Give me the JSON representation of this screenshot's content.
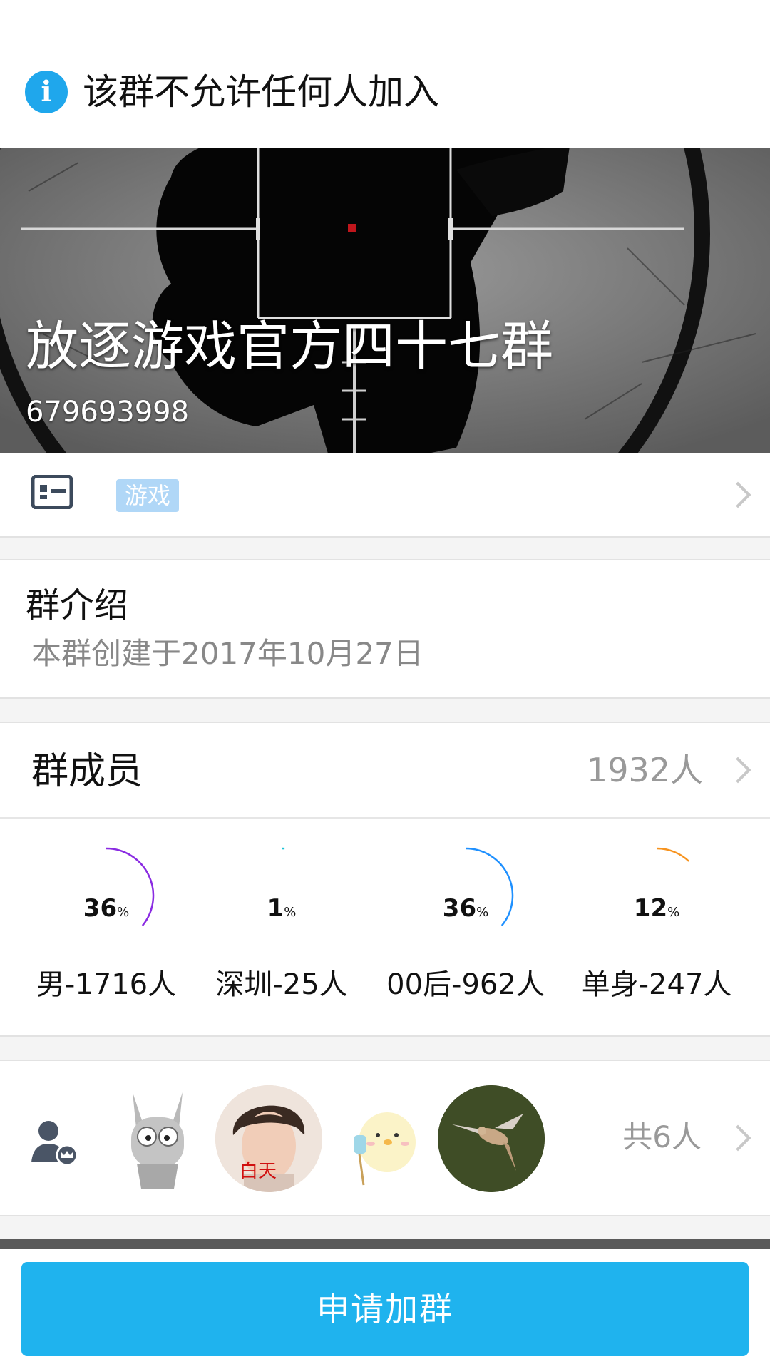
{
  "notice": {
    "icon": "info-icon",
    "text": "该群不允许任何人加入"
  },
  "banner": {
    "group_name": "放逐游戏官方四十七群",
    "group_id": "679693998"
  },
  "tag_row": {
    "card_icon": "id-card-icon",
    "tag": "游戏"
  },
  "intro": {
    "title": "群介绍",
    "description": "本群创建于2017年10月27日"
  },
  "members": {
    "title": "群成员",
    "count": "1932人",
    "stats": [
      {
        "percent": 36,
        "percent_text": "36",
        "unit": "%",
        "label": "男-1716人",
        "color": "#8a2be2"
      },
      {
        "percent": 1,
        "percent_text": "1",
        "unit": "%",
        "label": "深圳-25人",
        "color": "#19c3d6"
      },
      {
        "percent": 36,
        "percent_text": "36",
        "unit": "%",
        "label": "00后-962人",
        "color": "#1e90ff"
      },
      {
        "percent": 12,
        "percent_text": "12",
        "unit": "%",
        "label": "单身-247人",
        "color": "#f7931e"
      }
    ]
  },
  "admins": {
    "icon": "admin-crown-icon",
    "avatars": [
      "robot-avatar",
      "boy-portrait-avatar",
      "duck-cartoon-avatar",
      "hummingbird-avatar"
    ],
    "avatar_overlay_text": "白天",
    "total": "共6人"
  },
  "action": {
    "label": "申请加群"
  },
  "colors": {
    "accent": "#1fb3ee",
    "info": "#1fa7ec",
    "tag_bg": "#b0d7f7"
  }
}
